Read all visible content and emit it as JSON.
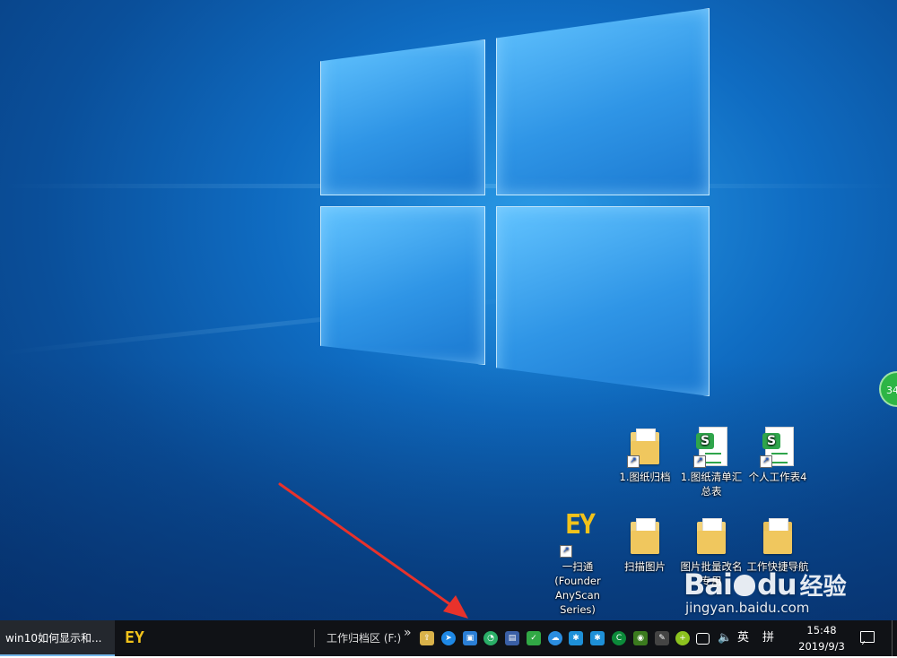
{
  "desktop": {
    "icons": [
      {
        "label": "1.图纸归档",
        "kind": "folder"
      },
      {
        "label": "1.图纸清单汇总表",
        "kind": "sheet"
      },
      {
        "label": "个人工作表4",
        "kind": "sheet"
      },
      {
        "label": "一扫通(Founder AnyScan Series)",
        "kind": "ey"
      },
      {
        "label": "扫描图片",
        "kind": "folder"
      },
      {
        "label": "图片批量改名专用",
        "kind": "folder"
      },
      {
        "label": "工作快捷导航",
        "kind": "folder"
      }
    ],
    "bubble_text": "34"
  },
  "watermark": {
    "logo": "Bai",
    "logo_tail": "du",
    "jingyan": "经验",
    "url": "jingyan.baidu.com"
  },
  "taskbar": {
    "task_label": "win10如何显示和...",
    "ey_label": "EY",
    "drive_label": "工作归档区 (F:)",
    "chevron": "»",
    "language": "英",
    "ime": "拼",
    "time": "15:48",
    "date": "2019/9/3",
    "tray_icons": [
      "folder-upload-icon",
      "thunder-icon",
      "box-icon",
      "wechat-icon",
      "display-icon",
      "shield-icon",
      "cloud-icon",
      "star-icon",
      "star2-icon",
      "green-c-icon",
      "nvidia-icon",
      "pen-icon",
      "plus-icon",
      "network-icon",
      "volume-icon"
    ]
  },
  "colors": {
    "taskbar_bg": "#101216",
    "accent": "#76b9ed",
    "arrow": "#e8322b"
  }
}
